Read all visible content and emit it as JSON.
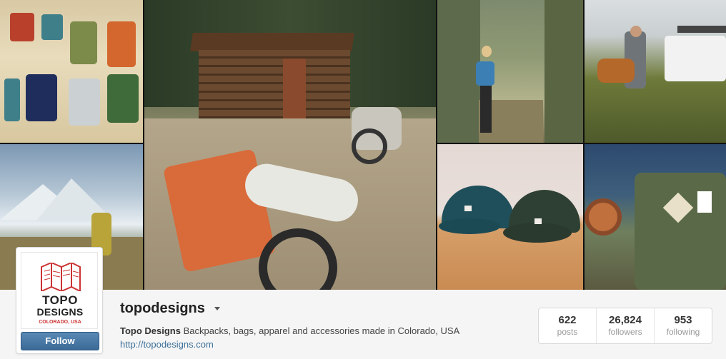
{
  "profile": {
    "username": "topodesigns",
    "full_name": "Topo Designs",
    "bio": "Backpacks, bags, apparel and accessories made in Colorado, USA",
    "website": "http://topodesigns.com",
    "follow_label": "Follow",
    "logo": {
      "line1": "TOPO",
      "line2": "DESIGNS",
      "line3": "COLORADO, USA"
    }
  },
  "stats": [
    {
      "value": "622",
      "label": "posts"
    },
    {
      "value": "26,824",
      "label": "followers"
    },
    {
      "value": "953",
      "label": "following"
    }
  ],
  "colors": {
    "follow_button": "#3f729b",
    "link": "#3f729b",
    "logo_red": "#cc3333"
  }
}
